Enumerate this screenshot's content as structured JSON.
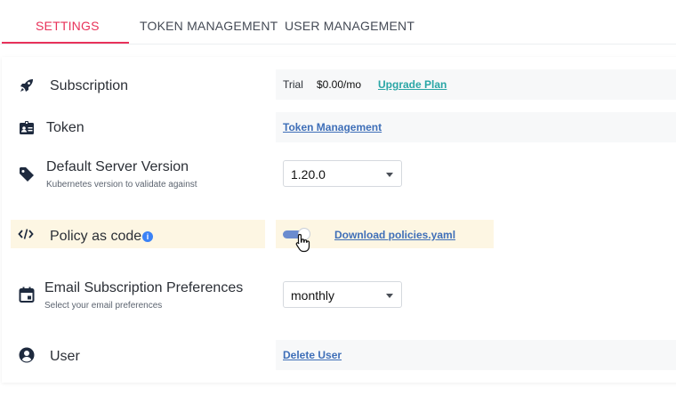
{
  "tabs": [
    {
      "label": "SETTINGS",
      "active": true
    },
    {
      "label": "TOKEN MANAGEMENT",
      "active": false
    },
    {
      "label": "USER MANAGEMENT",
      "active": false
    }
  ],
  "colors": {
    "accent": "#e8325a",
    "link": "#3f6fb8",
    "upgrade_link": "#2aa6a6",
    "highlight": "#fdf6e3"
  },
  "settings": {
    "subscription": {
      "label": "Subscription",
      "icon": "rocket-icon",
      "plan": "Trial",
      "price": "$0.00/mo",
      "upgrade_label": "Upgrade Plan"
    },
    "token": {
      "label": "Token",
      "icon": "id-card-icon",
      "link_label": "Token Management"
    },
    "server_version": {
      "label": "Default Server Version",
      "sublabel": "Kubernetes version to validate against",
      "icon": "tag-icon",
      "selected": "1.20.0"
    },
    "policy": {
      "label": "Policy as code",
      "icon": "code-icon",
      "toggle_on": true,
      "download_label": "Download policies.yaml"
    },
    "email": {
      "label": "Email Subscription Preferences",
      "sublabel": "Select your email preferences",
      "icon": "calendar-icon",
      "selected": "monthly"
    },
    "user": {
      "label": "User",
      "icon": "user-circle-icon",
      "delete_label": "Delete User"
    }
  }
}
